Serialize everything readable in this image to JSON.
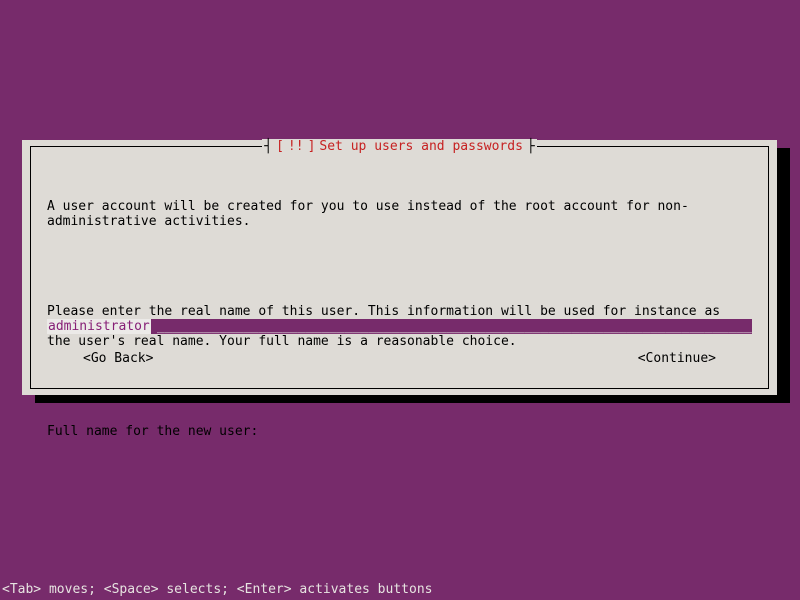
{
  "title": {
    "left_deco": "┤",
    "mark_open": " [",
    "bang": "!!",
    "mark_close": "] ",
    "text": "Set up users and passwords",
    "right_deco": " ├"
  },
  "body": {
    "para1": "A user account will be created for you to use instead of the root account for non-administrative activities.",
    "para2": "Please enter the real name of this user. This information will be used for instance as default origin for emails sent by this user as well as any program which displays or uses the user's real name. Your full name is a reasonable choice.",
    "prompt": "Full name for the new user:"
  },
  "input": {
    "value": "administrator",
    "underscore_fill": "____________________________________________________________________________"
  },
  "nav": {
    "back": "<Go Back>",
    "continue": "<Continue>"
  },
  "footer": "<Tab> moves; <Space> selects; <Enter> activates buttons"
}
